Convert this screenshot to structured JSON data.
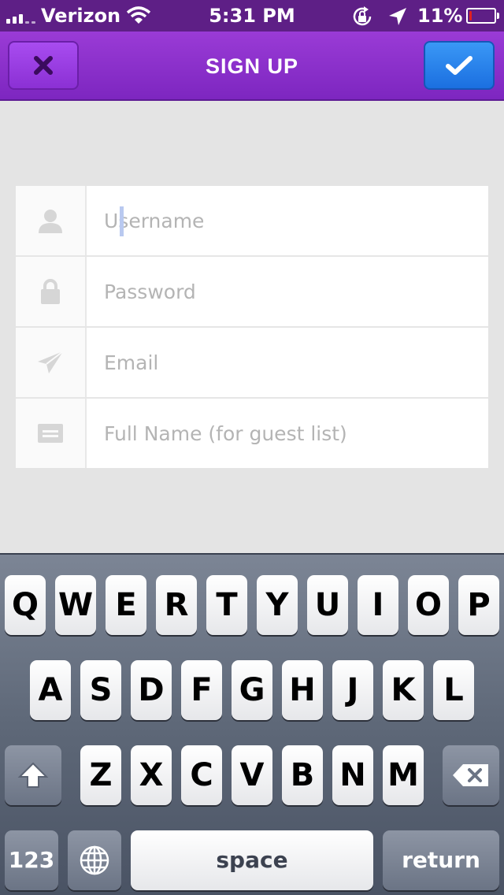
{
  "status_bar": {
    "carrier": "Verizon",
    "time": "5:31 PM",
    "battery_percent": "11%",
    "battery_level": 0.11
  },
  "nav": {
    "title": "SIGN UP",
    "close_icon": "close-icon",
    "done_icon": "checkmark-icon",
    "colors": {
      "bar": "#8a2fcc",
      "done_button": "#2a84ee"
    }
  },
  "form": {
    "fields": [
      {
        "icon": "user-icon",
        "placeholder": "Username",
        "value": ""
      },
      {
        "icon": "lock-icon",
        "placeholder": "Password",
        "value": ""
      },
      {
        "icon": "paper-plane-icon",
        "placeholder": "Email",
        "value": ""
      },
      {
        "icon": "id-card-icon",
        "placeholder": "Full Name (for guest list)",
        "value": ""
      }
    ]
  },
  "keyboard": {
    "row1": [
      "Q",
      "W",
      "E",
      "R",
      "T",
      "Y",
      "U",
      "I",
      "O",
      "P"
    ],
    "row2": [
      "A",
      "S",
      "D",
      "F",
      "G",
      "H",
      "J",
      "K",
      "L"
    ],
    "row3": [
      "Z",
      "X",
      "C",
      "V",
      "B",
      "N",
      "M"
    ],
    "numbers_label": "123",
    "space_label": "space",
    "return_label": "return"
  }
}
